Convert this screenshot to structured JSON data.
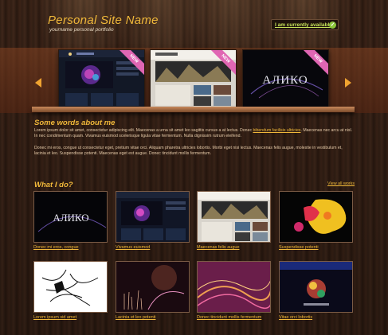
{
  "header": {
    "title": "Personal Site Name",
    "tagline": "yourname personal portfolio",
    "availability": "I am currently available"
  },
  "slider": {
    "badge": "NEW",
    "items": [
      {
        "name": "dark-website-screenshot"
      },
      {
        "name": "creative-by-nature-screenshot"
      },
      {
        "name": "aliko-artwork",
        "text": "АЛИКО"
      }
    ]
  },
  "about": {
    "title": "Some words about me",
    "para1_a": "Lorem ipsum dolor sit amet, consectetur adipiscing elit. Maecenas a urna sit amet leo sagittis cursus a at lectus. Donec ",
    "para1_link": "bibendum facilisis ultricies",
    "para1_b": ". Maecenas nec arcu at nisl. In nec condimentum quam. Vivamus euismod scelerisque ligula vitae fermentum. Nulla dignissim rutrum eleifend.",
    "para2": "Donec mi eros, congue ut consectetur eget, pretium vitae orci. Aliquam pharetra ultricies lobortis. Morbi eget nisi lectus. Maecenas felis augue, molestie in vestibulum et, lacinia et leo. Suspendisse potenti. Maecenas eget est augue. Donec tincidunt mollis fermentum."
  },
  "work": {
    "title": "What I do?",
    "view_all": "View all works",
    "items": [
      {
        "caption": "Donec mi eros, congue",
        "text": "АЛИКО"
      },
      {
        "caption": "Vivamus euismod"
      },
      {
        "caption": "Maecenas felis augue"
      },
      {
        "caption": "Suspendisse potenti"
      },
      {
        "caption": "Lorem ipsum sid amet"
      },
      {
        "caption": "Lacinia et leo potenti"
      },
      {
        "caption": "Donec tincidunt mollis fermentum"
      },
      {
        "caption": "Vitae orci lobortis"
      }
    ]
  },
  "colors": {
    "accent": "#f0b83a",
    "ribbon": "#e066b3",
    "available": "#c7e25a"
  }
}
